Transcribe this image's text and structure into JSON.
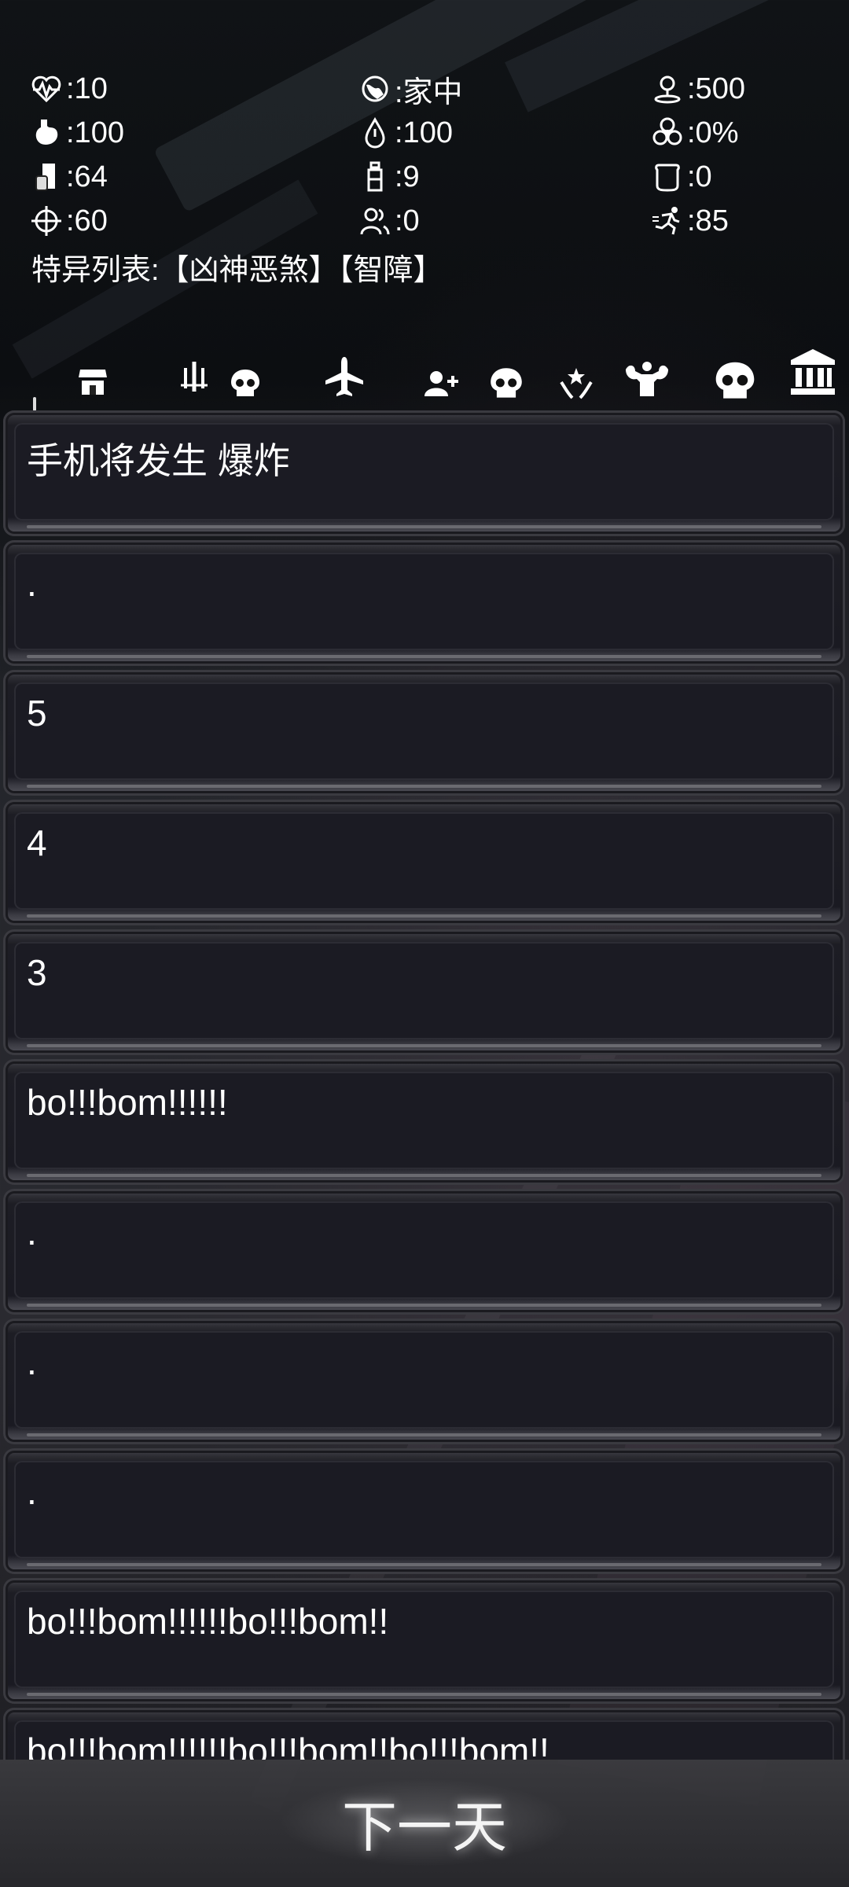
{
  "stats": [
    {
      "icon": "heartbeat-icon",
      "value": ":10"
    },
    {
      "icon": "location-pin-icon",
      "value": ":家中"
    },
    {
      "icon": "map-distance-icon",
      "value": ":500"
    },
    {
      "icon": "stomach-icon",
      "value": ":100"
    },
    {
      "icon": "water-drop-icon",
      "value": ":100"
    },
    {
      "icon": "biohazard-icon",
      "value": ":0%"
    },
    {
      "icon": "food-can-icon",
      "value": ":64"
    },
    {
      "icon": "water-bottle-icon",
      "value": ":9"
    },
    {
      "icon": "bandage-icon",
      "value": ":0"
    },
    {
      "icon": "crosshair-icon",
      "value": ":60"
    },
    {
      "icon": "survivors-icon",
      "value": ":0"
    },
    {
      "icon": "running-person-icon",
      "value": ":85"
    }
  ],
  "traits": "特异列表:【凶神恶煞】【智障】",
  "toolbar_icons": [
    "shop-icon",
    "weapons-icon",
    "skull-icon",
    "plane-icon",
    "add-person-icon",
    "skull-icon",
    "heal-hand-icon",
    "strength-icon",
    "skull-icon",
    "bank-icon"
  ],
  "feed": [
    {
      "text": "手机将发生 爆炸"
    },
    {
      "text": "."
    },
    {
      "text": "5"
    },
    {
      "text": "4"
    },
    {
      "text": "3"
    },
    {
      "text": "bo!!!bom!!!!!!"
    },
    {
      "text": "."
    },
    {
      "text": "."
    },
    {
      "text": "."
    },
    {
      "text": "bo!!!bom!!!!!!bo!!!bom!!"
    },
    {
      "text": "bo!!!bom!!!!!!bo!!!bom!!bo!!!bom!!"
    }
  ],
  "next_day_label": "下一天"
}
